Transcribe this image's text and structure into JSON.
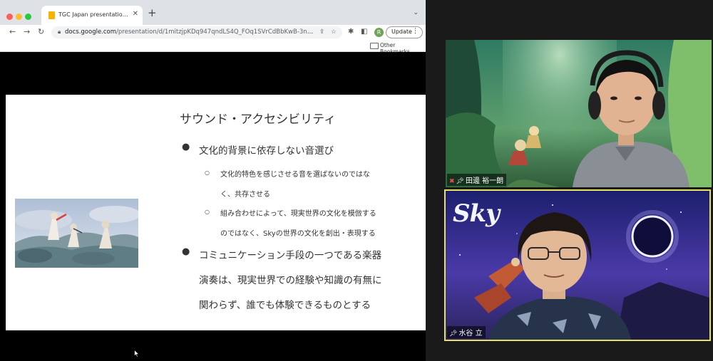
{
  "browser": {
    "tab": {
      "title": "TGC Japan presentation in Apr"
    },
    "url": {
      "host": "docs.google.com",
      "path": "/presentation/d/1mitzjpKDq947qndLS4Q_FOq1SVrCdBbKwB-3n29KvPU/..."
    },
    "profile_initial": "R",
    "update_label": "Update",
    "bookmarks": {
      "other_label": "Other Bookmarks"
    },
    "colors": {
      "close": "#ff5f57",
      "minimize": "#febc2e",
      "zoom": "#28c840",
      "slides_favicon": "#f4b400"
    }
  },
  "slide": {
    "title": "サウンド・アクセシビリティ",
    "bullets": [
      {
        "lines": [
          "文化的背景に依存しない音選び"
        ],
        "sub": [
          {
            "lines": [
              "文化的特色を感じさせる音を選ばないのではな",
              "く、共存させる"
            ]
          },
          {
            "lines": [
              "組み合わせによって、現実世界の文化を模倣する",
              "のではなく、Skyの世界の文化を創出・表現する"
            ]
          }
        ]
      },
      {
        "lines": [
          "コミュニケーション手段の一つである楽器",
          "演奏は、現実世界での経験や知識の有無に",
          "関わらず、誰でも体験できるものとする"
        ],
        "sub": []
      }
    ]
  },
  "participants": [
    {
      "name": "田邊 裕一朗",
      "muted": true,
      "active_speaker": false
    },
    {
      "name": "水谷 立",
      "muted": false,
      "active_speaker": true
    }
  ],
  "video": {
    "logo_text": "Sky"
  }
}
